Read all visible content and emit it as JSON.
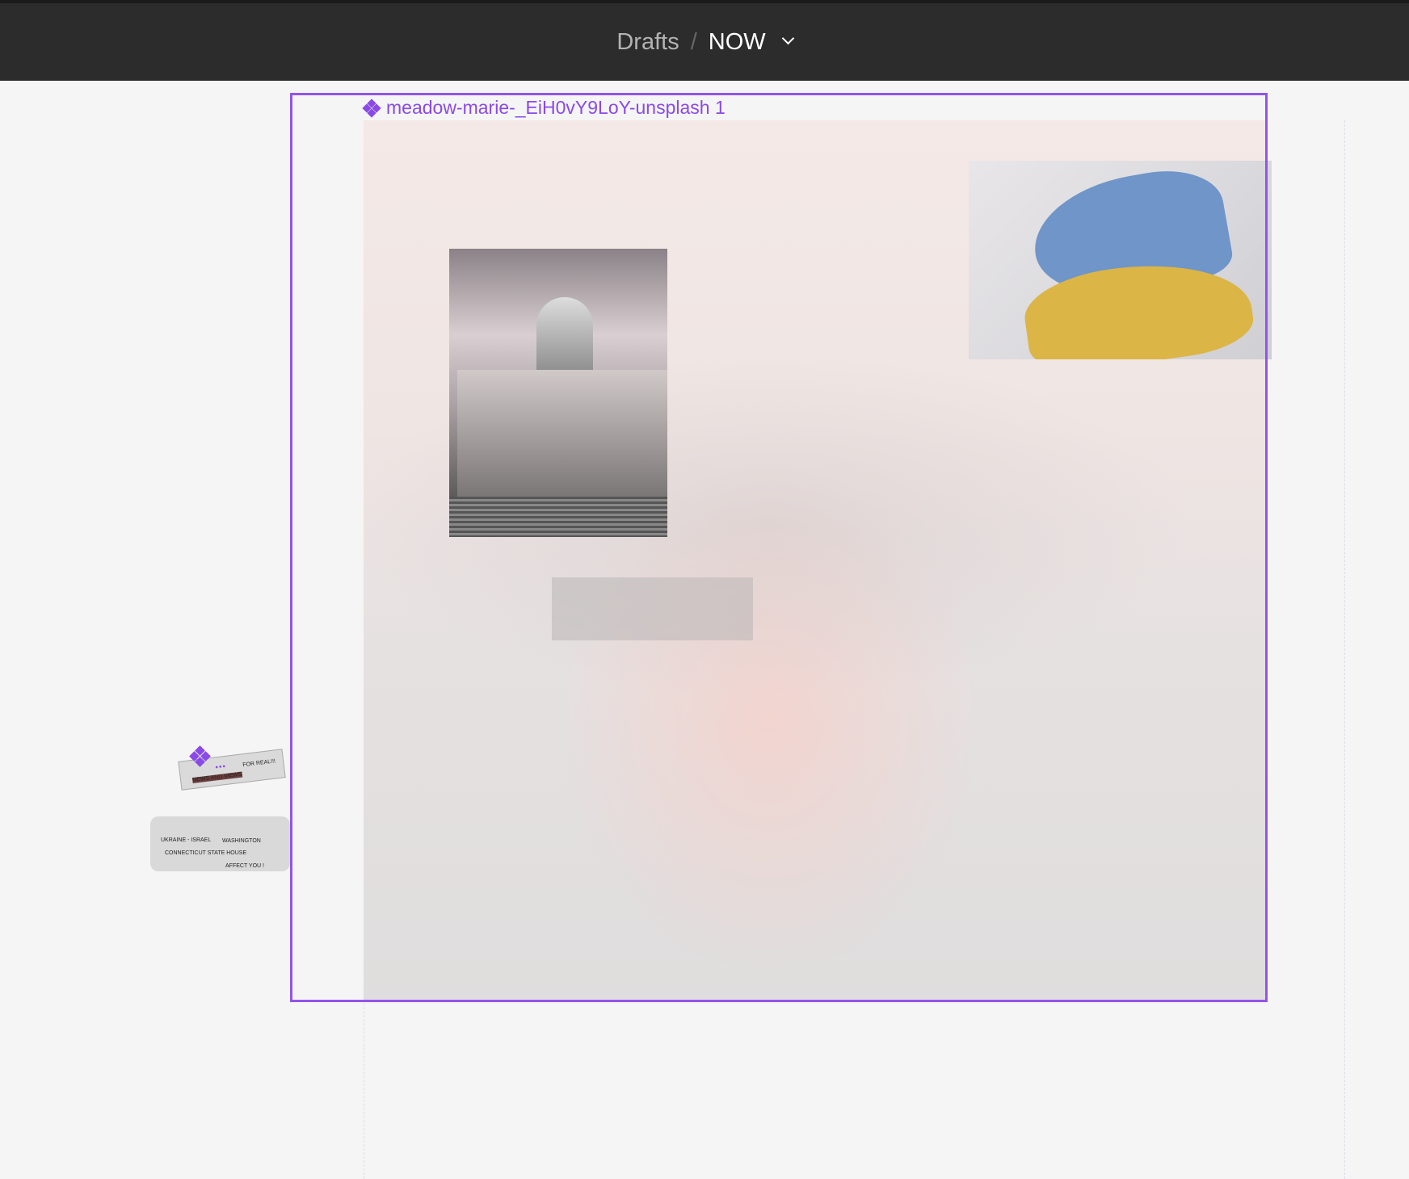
{
  "header": {
    "breadcrumb_parent": "Drafts",
    "separator": "/",
    "file_name": "NOW"
  },
  "frame": {
    "label": "meadow-marie-_EiH0vY9LoY-unsplash 1",
    "accent_color": "#9255ea"
  },
  "sticker": {
    "dots": "•••",
    "for_real": "FOR REAL!!!",
    "news": "NEWS AND VIEWS"
  },
  "card": {
    "ukraine": "UKRAINE - ISRAEL",
    "washington": "WASHINGTON",
    "connecticut": "CONNECTICUT STATE HOUSE",
    "affect": "AFFECT YOU !"
  }
}
